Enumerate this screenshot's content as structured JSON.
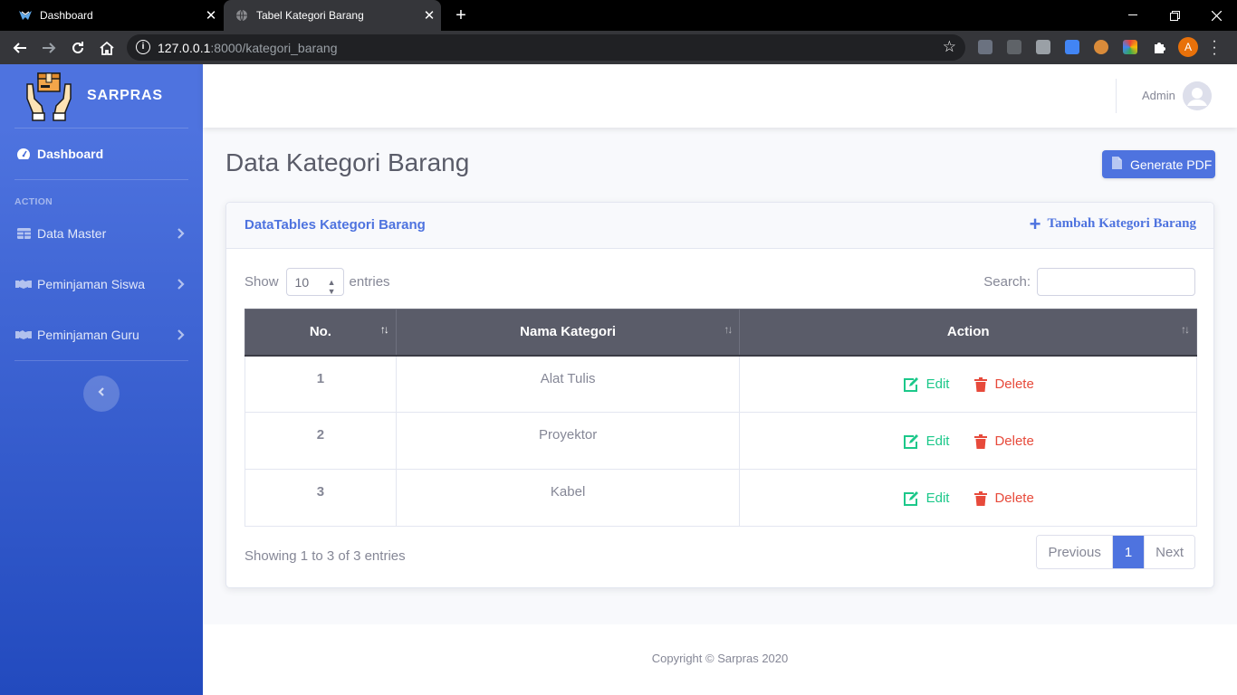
{
  "browser": {
    "tabs": [
      {
        "title": "Dashboard"
      },
      {
        "title": "Tabel Kategori Barang"
      }
    ],
    "url_host": "127.0.0.1",
    "url_rest": ":8000/kategori_barang",
    "profile_initial": "A"
  },
  "sidebar": {
    "brand": "SARPRAS",
    "dashboard_label": "Dashboard",
    "section_heading": "ACTION",
    "items": [
      {
        "label": "Data Master"
      },
      {
        "label": "Peminjaman Siswa"
      },
      {
        "label": "Peminjaman Guru"
      }
    ]
  },
  "topbar": {
    "user_name": "Admin"
  },
  "page": {
    "title": "Data Kategori Barang",
    "pdf_button": "Generate PDF"
  },
  "card": {
    "title": "DataTables Kategori Barang",
    "add_button": "Tambah Kategori Barang",
    "show_label": "Show",
    "entries_label": "entries",
    "page_length": "10",
    "search_label": "Search:",
    "search_value": "",
    "columns": [
      "No.",
      "Nama Kategori",
      "Action"
    ],
    "rows": [
      {
        "no": "1",
        "name": "Alat Tulis"
      },
      {
        "no": "2",
        "name": "Proyektor"
      },
      {
        "no": "3",
        "name": "Kabel"
      }
    ],
    "edit_label": "Edit",
    "delete_label": "Delete",
    "info": "Showing 1 to 3 of 3 entries",
    "pagination": {
      "previous": "Previous",
      "current": "1",
      "next": "Next"
    }
  },
  "footer": {
    "text": "Copyright © Sarpras 2020"
  },
  "colors": {
    "primary": "#4e73df",
    "success": "#1cc88a",
    "danger": "#e74a3b",
    "table_header": "#5a5c69"
  }
}
